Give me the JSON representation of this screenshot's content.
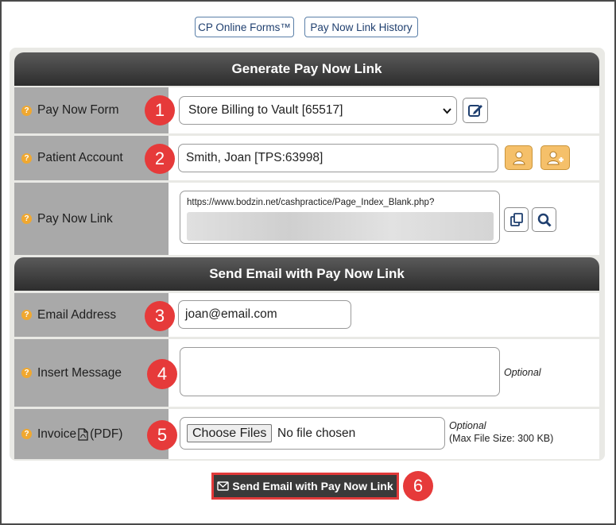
{
  "top_links": {
    "forms": "CP Online Forms™",
    "history": "Pay Now Link History"
  },
  "section1": {
    "title": "Generate Pay Now Link"
  },
  "section2": {
    "title": "Send Email with Pay Now Link"
  },
  "form": {
    "pay_now_form": {
      "label": "Pay Now Form",
      "value": "Store Billing to Vault [65517]",
      "badge": "1"
    },
    "patient_account": {
      "label": "Patient Account",
      "value": "Smith, Joan [TPS:63998]",
      "badge": "2"
    },
    "pay_now_link": {
      "label": "Pay Now Link",
      "value": "https://www.bodzin.net/cashpractice/Page_Index_Blank.php?"
    },
    "email": {
      "label": "Email Address",
      "value": "joan@email.com",
      "badge": "3"
    },
    "message": {
      "label": "Insert Message",
      "optional": "Optional",
      "badge": "4"
    },
    "invoice": {
      "label": "Invoice",
      "pdf": "(PDF)",
      "button": "Choose Files",
      "status": "No file chosen",
      "optional": "Optional",
      "max_size": "(Max File Size: 300 KB)",
      "badge": "5"
    }
  },
  "send_button": {
    "label": "Send Email with Pay Now Link",
    "badge": "6"
  },
  "colors": {
    "accent_red": "#e63a3a",
    "header_dark": "#2d2d2d",
    "help_orange": "#f0a830"
  }
}
